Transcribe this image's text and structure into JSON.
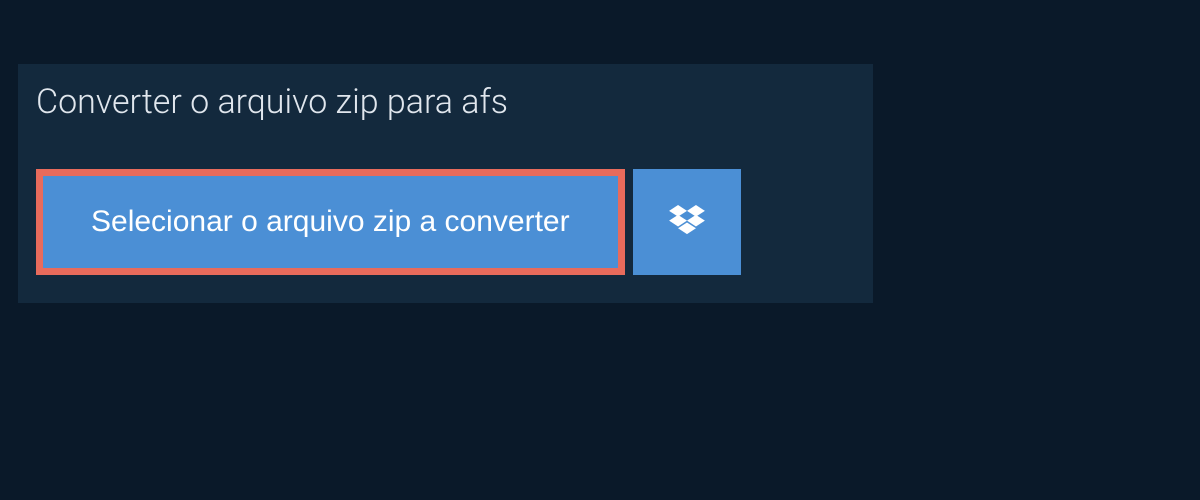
{
  "converter": {
    "tab_title": "Converter o arquivo zip para afs",
    "select_button_label": "Selecionar o arquivo zip a converter",
    "colors": {
      "background": "#0a1929",
      "panel": "#13293d",
      "button": "#4b8fd5",
      "highlight_border": "#e86b5c",
      "text_light": "#e0e6ed",
      "text_white": "#ffffff"
    }
  }
}
